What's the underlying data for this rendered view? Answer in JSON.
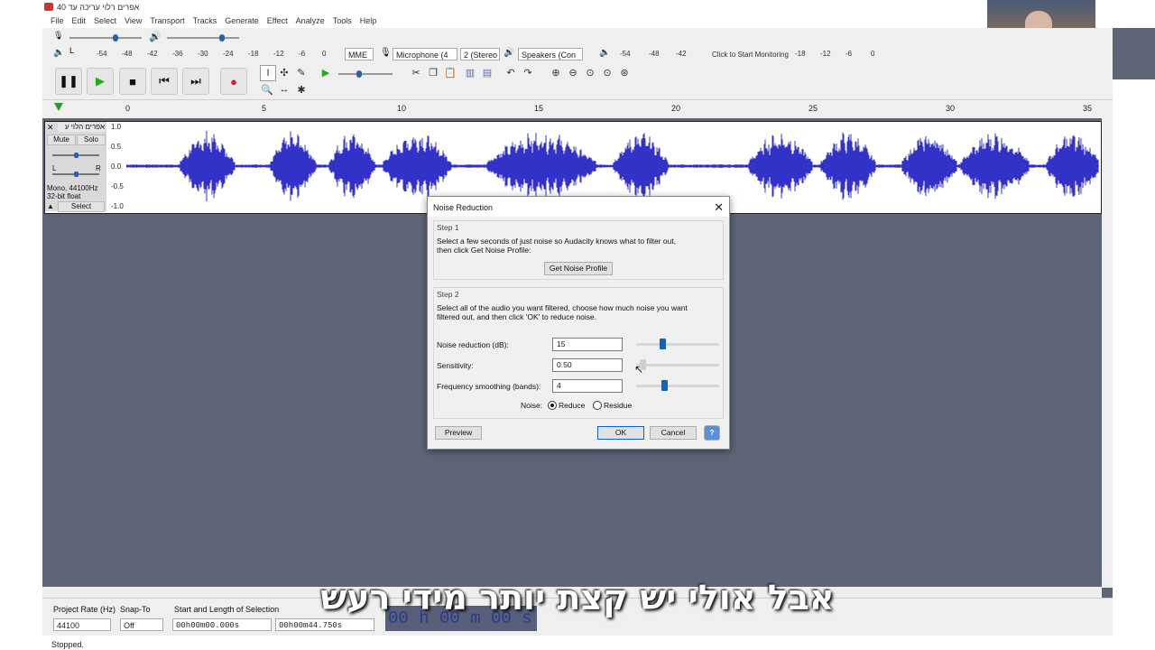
{
  "window": {
    "title": "אפרים רלוי עריכה עד 40"
  },
  "menu": [
    "File",
    "Edit",
    "Select",
    "View",
    "Transport",
    "Tracks",
    "Generate",
    "Effect",
    "Analyze",
    "Tools",
    "Help"
  ],
  "meter": {
    "scale_top": [
      "-54",
      "-48",
      "-42",
      "-36",
      "-30",
      "-24",
      "-18",
      "-12",
      "-6",
      "0"
    ],
    "scale_right": [
      "-54",
      "-48",
      "-42",
      "-18",
      "-12",
      "-6",
      "0"
    ],
    "click_to_monitor": "Click to Start Monitoring",
    "lr_l": "L",
    "lr_r": "R"
  },
  "device": {
    "host": "MME",
    "microphone": "Microphone (4",
    "channels": "2 (Stereo",
    "speakers": "Speakers (Con"
  },
  "ruler": [
    "0",
    "5",
    "10",
    "15",
    "20",
    "25",
    "30",
    "35"
  ],
  "track": {
    "name": "אפרים הלוי ע",
    "mute": "Mute",
    "solo": "Solo",
    "lr_l": "L",
    "lr_r": "R",
    "info": "Mono, 44100Hz",
    "format": "32-bit float",
    "select": "Select",
    "scale": [
      "1.0",
      "0.5",
      "0.0",
      "-0.5",
      "-1.0"
    ]
  },
  "dialog": {
    "title": "Noise Reduction",
    "step1_label": "Step 1",
    "step1_text_1": "Select a few seconds of just noise so Audacity knows what to filter out,",
    "step1_text_2": "then click Get Noise Profile:",
    "get_profile_button": "Get Noise Profile",
    "step2_label": "Step 2",
    "step2_text_1": "Select all of the audio you want filtered, choose how much noise you want",
    "step2_text_2": "filtered out, and then click 'OK' to reduce noise.",
    "noise_reduction_label": "Noise reduction (dB):",
    "noise_reduction_value": "15",
    "noise_reduction_level": 0.3,
    "sensitivity_label": "Sensitivity:",
    "sensitivity_value": "0.50",
    "sensitivity_level": 0.05,
    "freq_smoothing_label": "Frequency smoothing (bands):",
    "freq_smoothing_value": "4",
    "freq_smoothing_level": 0.33,
    "noise_label": "Noise:",
    "reduce_label": "Reduce",
    "residue_label": "Residue",
    "preview_button": "Preview",
    "ok_button": "OK",
    "cancel_button": "Cancel",
    "help_glyph": "?"
  },
  "bottom": {
    "project_rate_label": "Project Rate (Hz)",
    "project_rate_value": "44100",
    "snap_to_label": "Snap-To",
    "snap_to_value": "Off",
    "selection_label": "Start and Length of Selection",
    "start_time": "00h00m00.000s",
    "length_time": "00h00m44.750s",
    "big_time": "00 h 00 m 00 s"
  },
  "status": "Stopped.",
  "subtitle": "אבל אולי יש קצת יותר מידי רעש",
  "colors": {
    "waveform": "#3232c8",
    "accent": "#0a64c8",
    "record": "#e02020",
    "play": "#22aa22"
  }
}
